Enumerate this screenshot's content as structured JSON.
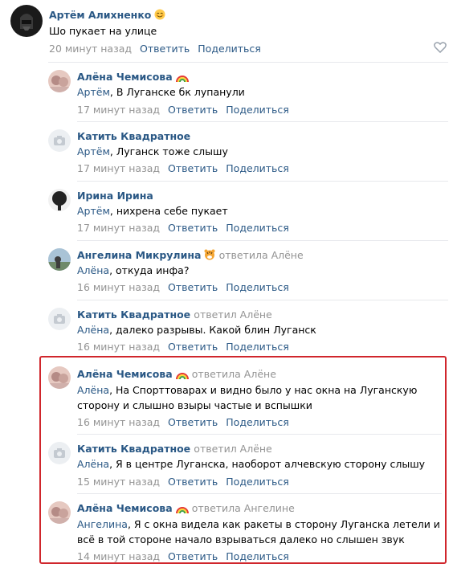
{
  "comments": [
    {
      "name": "Артём Алихненко",
      "emoji": "blush",
      "reply_to": "",
      "replied_label": "",
      "text": "Шо пукает на улице",
      "time": "20 минут назад",
      "reply": "Ответить",
      "share": "Поделиться",
      "avatar": "darth-vader"
    },
    {
      "name": "Алёна Чемисова",
      "emoji": "rainbow",
      "reply_to": "Артём",
      "replied_label": "",
      "text": ", В Луганске бк лупанули",
      "time": "17 минут назад",
      "reply": "Ответить",
      "share": "Поделиться",
      "avatar": "photo-pink"
    },
    {
      "name": "Катить Квадратное",
      "emoji": "",
      "reply_to": "Артём",
      "replied_label": "",
      "text": ", Луганск тоже слышу",
      "time": "17 минут назад",
      "reply": "Ответить",
      "share": "Поделиться",
      "avatar": "camera"
    },
    {
      "name": "Ирина Ирина",
      "emoji": "",
      "reply_to": "Артём",
      "replied_label": "",
      "text": ", нихрена себе пукает",
      "time": "17 минут назад",
      "reply": "Ответить",
      "share": "Поделиться",
      "avatar": "dark-figure"
    },
    {
      "name": "Ангелина Микрулина",
      "emoji": "tiger",
      "reply_to": "Алёна",
      "replied_label": "ответила Алёне",
      "text": ", откуда инфа?",
      "time": "16 минут назад",
      "reply": "Ответить",
      "share": "Поделиться",
      "avatar": "photo-landscape"
    },
    {
      "name": "Катить Квадратное",
      "emoji": "",
      "reply_to": "Алёна",
      "replied_label": "ответил Алёне",
      "text": ", далеко разрывы. Какой блин Луганск",
      "time": "16 минут назад",
      "reply": "Ответить",
      "share": "Поделиться",
      "avatar": "camera"
    },
    {
      "name": "Алёна Чемисова",
      "emoji": "rainbow",
      "reply_to": "Алёна",
      "replied_label": "ответила Алёне",
      "text": ", На Спорттоварах и видно было у нас окна на Луганскую",
      "text2": "сторону и слышно взыры частые и вспышки",
      "time": "16 минут назад",
      "reply": "Ответить",
      "share": "Поделиться",
      "avatar": "photo-pink"
    },
    {
      "name": "Катить Квадратное",
      "emoji": "",
      "reply_to": "Алёна",
      "replied_label": "ответил Алёне",
      "text": ", Я в центре Луганска, наоборот алчевскую сторону слышу",
      "time": "15 минут назад",
      "reply": "Ответить",
      "share": "Поделиться",
      "avatar": "camera"
    },
    {
      "name": "Алёна Чемисова",
      "emoji": "rainbow",
      "reply_to": "Ангелина",
      "replied_label": "ответила Ангелине",
      "text": ", Я с окна видела как ракеты в сторону Луганска летели и",
      "text2": "всё в той стороне начало взрываться далеко но слышен звук",
      "time": "14 минут назад",
      "reply": "Ответить",
      "share": "Поделиться",
      "avatar": "photo-pink"
    }
  ],
  "colors": {
    "link": "#2a5885",
    "muted": "#939393",
    "highlight": "#d0262c"
  }
}
